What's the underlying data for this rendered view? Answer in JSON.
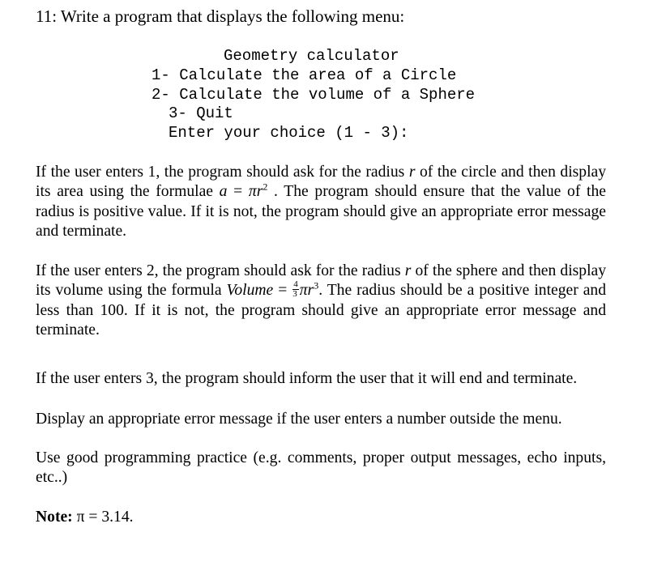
{
  "question": {
    "heading": "11: Write a program that displays the following menu:"
  },
  "menu": {
    "title": "Geometry calculator",
    "option1": "1- Calculate the area of a Circle",
    "option2": "2- Calculate the volume of a Sphere",
    "option3": "3- Quit",
    "prompt": "Enter your choice (1 - 3):"
  },
  "para1": {
    "part1": "If the user enters 1, the program should ask for the radius ",
    "var_r": "r",
    "part2": " of the circle and then display its area using the formulae ",
    "formula_a": "a",
    "formula_eq": " = ",
    "formula_pi": "π",
    "formula_r": "r",
    "formula_exp": "2",
    "part3": " . The program should ensure that the value of the radius is positive value. If it is not, the program should give an appropriate error message and terminate."
  },
  "para2": {
    "part1": "If the user enters 2, the program should ask for the radius ",
    "var_r": "r",
    "part2": " of the sphere and then display its volume using the formula ",
    "formula_lhs": "Volume",
    "formula_eq": " = ",
    "frac_num": "4",
    "frac_den": "3",
    "formula_pi": "π",
    "formula_r": "r",
    "formula_exp": "3",
    "part3": ".  The radius should be a positive integer and less than 100. If it is not, the program should give an appropriate error message and terminate."
  },
  "para3": "If the user enters 3, the program should inform the user that it will end and terminate.",
  "para4": "Display an appropriate error message if the user enters a number outside the menu.",
  "para5": "Use good programming practice (e.g. comments, proper output messages, echo inputs, etc..)",
  "note": {
    "label": "Note:",
    "text": " π = 3.14."
  }
}
